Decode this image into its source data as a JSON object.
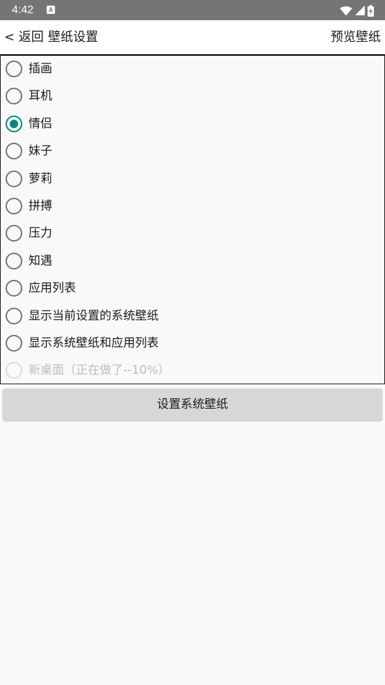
{
  "status_bar": {
    "time": "4:42",
    "notification_icon": "a-box-icon",
    "wifi_icon": "wifi-icon",
    "signal_icon": "cell-signal-icon",
    "battery_icon": "battery-charging-icon"
  },
  "header": {
    "back_label": "< 返回",
    "title": "壁纸设置",
    "preview_label": "预览壁纸"
  },
  "options": [
    {
      "label": "插画",
      "checked": false,
      "enabled": true
    },
    {
      "label": "耳机",
      "checked": false,
      "enabled": true
    },
    {
      "label": "情侣",
      "checked": true,
      "enabled": true
    },
    {
      "label": "妹子",
      "checked": false,
      "enabled": true
    },
    {
      "label": "萝莉",
      "checked": false,
      "enabled": true
    },
    {
      "label": "拼搏",
      "checked": false,
      "enabled": true
    },
    {
      "label": "压力",
      "checked": false,
      "enabled": true
    },
    {
      "label": "知遇",
      "checked": false,
      "enabled": true
    },
    {
      "label": "应用列表",
      "checked": false,
      "enabled": true
    },
    {
      "label": "显示当前设置的系统壁纸",
      "checked": false,
      "enabled": true
    },
    {
      "label": "显示系统壁纸和应用列表",
      "checked": false,
      "enabled": true
    },
    {
      "label": "新桌面（正在做了--10%）",
      "checked": false,
      "enabled": false
    }
  ],
  "actions": {
    "set_wallpaper_label": "设置系统壁纸"
  },
  "colors": {
    "accent": "#00897b",
    "status_bar": "#757575"
  }
}
